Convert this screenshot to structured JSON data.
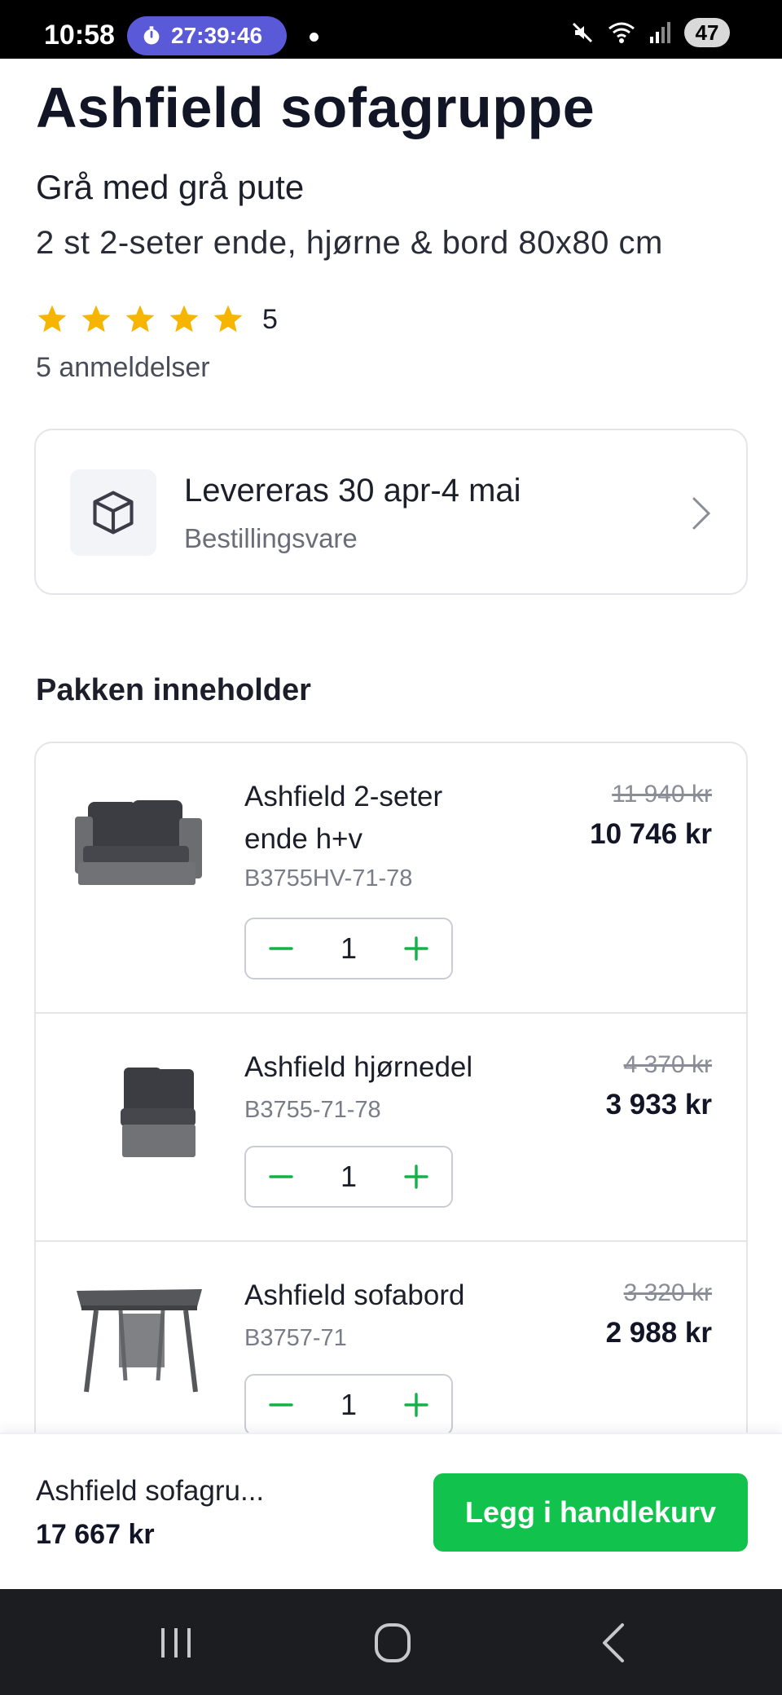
{
  "status_bar": {
    "time": "10:58",
    "timer": "27:39:46",
    "battery": "47"
  },
  "product": {
    "title": "Ashfield sofagruppe",
    "subtitle": "Grå med grå pute",
    "description": "2 st 2-seter ende, hjørne & bord 80x80 cm",
    "rating": "5",
    "rating_value": 5,
    "reviews": "5 anmeldelser"
  },
  "delivery": {
    "title": "Levereras 30 apr-4 mai",
    "subtitle": "Bestillingsvare",
    "icon": "package-box-icon"
  },
  "package": {
    "heading": "Pakken inneholder",
    "items": [
      {
        "name": "Ashfield 2-seter ende h+v",
        "sku": "B3755HV-71-78",
        "old_price": "11 940 kr",
        "price": "10 746 kr",
        "quantity": "1"
      },
      {
        "name": "Ashfield hjørnedel",
        "sku": "B3755-71-78",
        "old_price": "4 370 kr",
        "price": "3 933 kr",
        "quantity": "1"
      },
      {
        "name": "Ashfield sofabord",
        "sku": "B3757-71",
        "old_price": "3 320 kr",
        "price": "2 988 kr",
        "quantity": "1"
      }
    ]
  },
  "bottom_bar": {
    "name": "Ashfield sofagru...",
    "price": "17 667 kr",
    "button": "Legg i handlekurv"
  },
  "colors": {
    "accent": "#11c24c",
    "star": "#f5b500",
    "timer_pill": "#5a5ad8"
  }
}
